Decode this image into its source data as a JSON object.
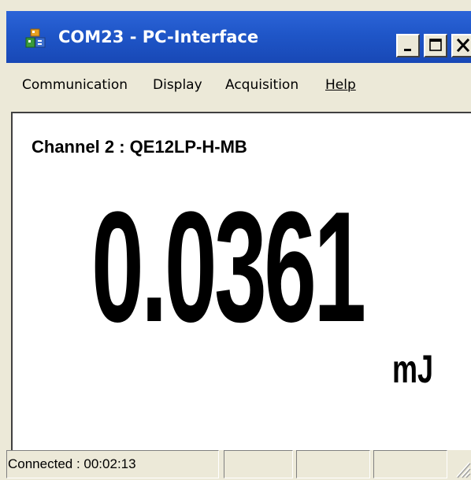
{
  "window": {
    "title": "COM23 - PC-Interface",
    "app_icon": "app-icon",
    "controls": {
      "minimize_glyph": "_",
      "maximize_icon": "maximize-icon",
      "close_icon": "close-icon"
    },
    "colors": {
      "titlebar": "#1f56c8",
      "titlebar_text": "#ffffff",
      "chrome": "#ece9d8"
    }
  },
  "menu": {
    "items": [
      {
        "label": "Communication"
      },
      {
        "label": "Display"
      },
      {
        "label": "Acquisition"
      },
      {
        "label": "Help"
      }
    ]
  },
  "display": {
    "channel_label": "Channel 2 : QE12LP-H-MB",
    "value": "0.0361",
    "unit": "mJ"
  },
  "statusbar": {
    "connection": "Connected : 00:02:13",
    "panel2": "",
    "panel3": "",
    "panel4": ""
  }
}
